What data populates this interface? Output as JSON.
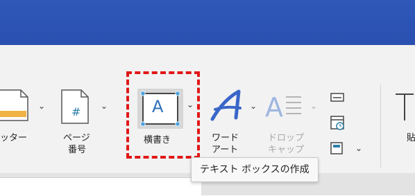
{
  "ribbon": {
    "footer_label": "ッター",
    "page_number_label_line1": "ページ",
    "page_number_label_line2": "番号",
    "page_number_glyph": "#",
    "textbox_label": "横書き",
    "textbox_glyph": "A",
    "wordart_label_line1": "ワード",
    "wordart_label_line2": "アート",
    "dropcap_label_line1": "ドロップ",
    "dropcap_label_line2": "キャップ",
    "next_label_partial": "貼"
  },
  "tooltip": {
    "text": "テキスト ボックスの作成"
  },
  "colors": {
    "title_bar": "#2f58b8",
    "highlight": "#e01818",
    "wordart_blue": "#3a66c8",
    "footer_orange": "#f0b245"
  }
}
